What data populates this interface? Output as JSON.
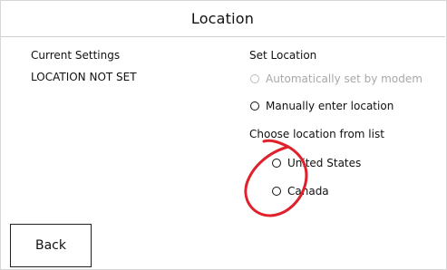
{
  "header": {
    "title": "Location"
  },
  "current_settings": {
    "heading": "Current Settings",
    "status": "LOCATION NOT SET"
  },
  "set_location": {
    "heading": "Set Location",
    "options": [
      {
        "label": "Automatically set by modem",
        "enabled": false,
        "selected": false
      },
      {
        "label": "Manually enter location",
        "enabled": true,
        "selected": false
      }
    ],
    "list_heading": "Choose location from list",
    "countries": [
      {
        "label": "United States",
        "selected": false
      },
      {
        "label": "Canada",
        "selected": false
      }
    ]
  },
  "footer": {
    "back_label": "Back"
  },
  "annotation": {
    "color": "#e0202a",
    "shape": "hand-drawn-circle"
  }
}
